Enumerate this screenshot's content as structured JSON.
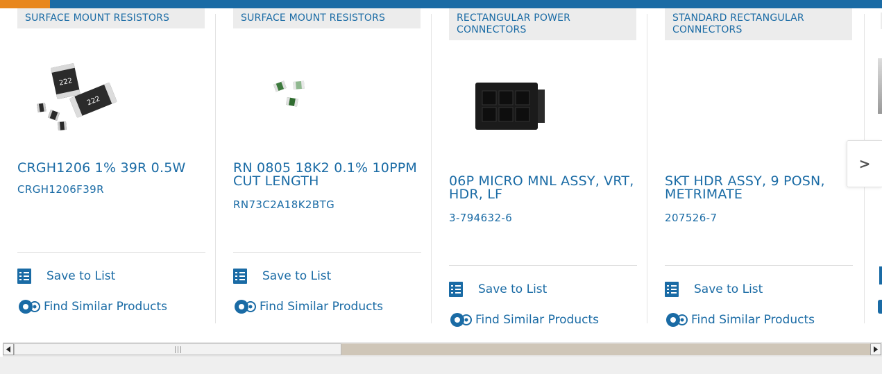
{
  "cards": [
    {
      "category": "SURFACE MOUNT RESISTORS",
      "title": "CRGH1206 1% 39R 0.5W",
      "part_number": "CRGH1206F39R",
      "image_icon": "smd-resistor-image"
    },
    {
      "category": "SURFACE MOUNT RESISTORS",
      "title": "RN 0805 18K2 0.1% 10PPM CUT LENGTH",
      "part_number": "RN73C2A18K2BTG",
      "image_icon": "smd-resistor-small-image"
    },
    {
      "category": "RECTANGULAR POWER CONNECTORS",
      "title": "06P MICRO MNL ASSY, VRT, HDR, LF",
      "part_number": "3-794632-6",
      "image_icon": "connector-image"
    },
    {
      "category": "STANDARD RECTANGULAR CONNECTORS",
      "title": "SKT HDR ASSY, 9 POSN, METRIMATE",
      "part_number": "207526-7",
      "image_icon": ""
    }
  ],
  "actions": {
    "save_to_list": "Save to List",
    "find_similar": "Find Similar Products"
  },
  "carousel": {
    "next_label": ">"
  },
  "colors": {
    "brand_blue": "#1a6ba5",
    "accent_orange": "#e8871e"
  }
}
